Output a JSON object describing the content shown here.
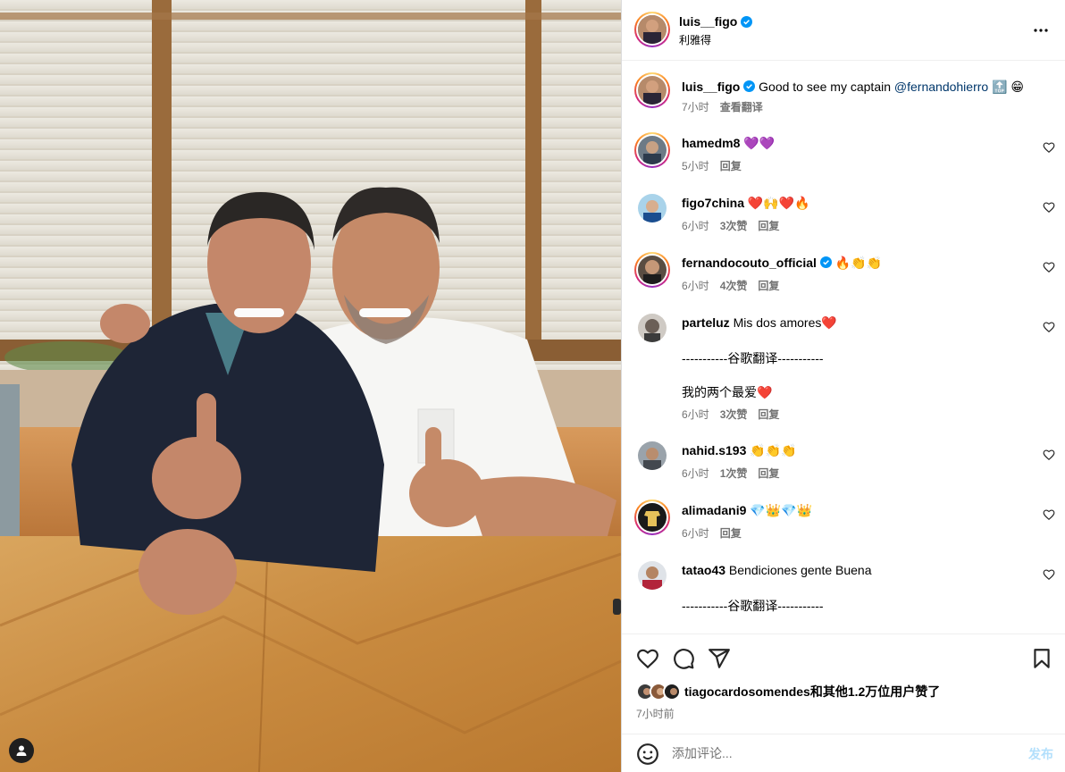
{
  "header": {
    "username": "luis__figo",
    "location": "利雅得",
    "more_icon": "more-horizontal-icon"
  },
  "caption": {
    "username": "luis__figo",
    "text": "Good to see my captain",
    "mention": "@fernandohierro",
    "emoji": "🔝 😁",
    "time": "7小时",
    "see_translation": "查看翻译"
  },
  "comments": [
    {
      "username": "hamedm8",
      "text": "💜💜",
      "time": "5小时",
      "likes": "",
      "reply": "回复"
    },
    {
      "username": "figo7china",
      "text": "❤️🙌❤️🔥",
      "time": "6小时",
      "likes": "3次赞",
      "reply": "回复"
    },
    {
      "username": "fernandocouto_official",
      "text": "🔥👏👏",
      "time": "6小时",
      "likes": "4次赞",
      "reply": "回复"
    },
    {
      "username": "parteluz",
      "text": "Mis dos amores❤️",
      "divider": "-----------谷歌翻译-----------",
      "translated": "我的两个最爱❤️",
      "time": "6小时",
      "likes": "3次赞",
      "reply": "回复"
    },
    {
      "username": "nahid.s193",
      "text": "👏👏👏",
      "time": "6小时",
      "likes": "1次赞",
      "reply": "回复"
    },
    {
      "username": "alimadani9",
      "text": "💎👑💎👑",
      "time": "6小时",
      "likes": "",
      "reply": "回复"
    },
    {
      "username": "tatao43",
      "text": "Bendiciones gente Buena",
      "divider": "-----------谷歌翻译-----------"
    }
  ],
  "actions": {
    "like_icon": "heart-icon",
    "comment_icon": "comment-icon",
    "share_icon": "send-icon",
    "save_icon": "bookmark-icon",
    "liked_by_text": "tiagocardosomendes和其他1.2万位用户赞了",
    "posted_time": "7小时前"
  },
  "composer": {
    "placeholder": "添加评论...",
    "post_label": "发布"
  },
  "colors": {
    "link": "#00376b",
    "secondary": "#737373",
    "verified": "#0095f6",
    "post_disabled": "#b2dffc"
  }
}
